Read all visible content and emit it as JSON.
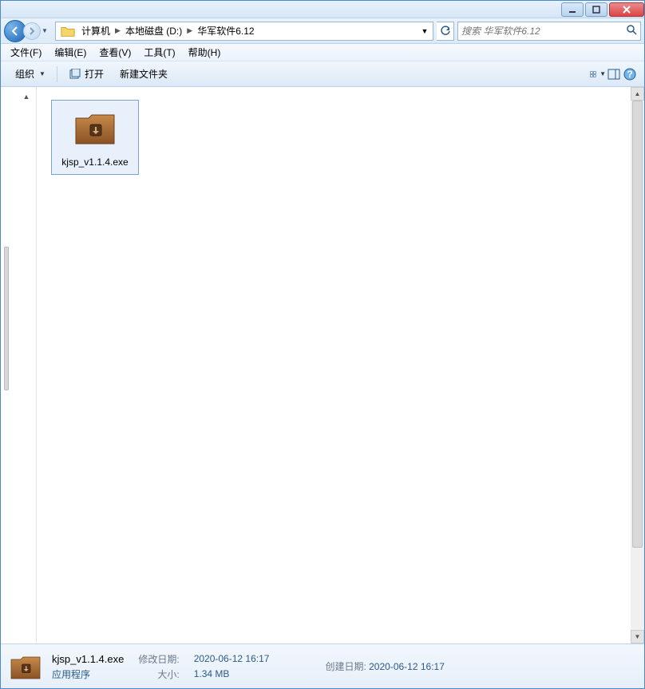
{
  "titlebar": {
    "title": ""
  },
  "breadcrumb": {
    "items": [
      "计算机",
      "本地磁盘 (D:)",
      "华军软件6.12"
    ]
  },
  "search": {
    "placeholder": "搜索 华军软件6.12"
  },
  "menu": {
    "file": "文件(F)",
    "edit": "编辑(E)",
    "view": "查看(V)",
    "tools": "工具(T)",
    "help": "帮助(H)"
  },
  "toolbar": {
    "organize": "组织",
    "open": "打开",
    "new_folder": "新建文件夹"
  },
  "files": [
    {
      "name": "kjsp_v1.1.4.exe"
    }
  ],
  "details": {
    "name": "kjsp_v1.1.4.exe",
    "type": "应用程序",
    "modified_label": "修改日期:",
    "modified": "2020-06-12 16:17",
    "size_label": "大小:",
    "size": "1.34 MB",
    "created_label": "创建日期:",
    "created": "2020-06-12 16:17"
  }
}
